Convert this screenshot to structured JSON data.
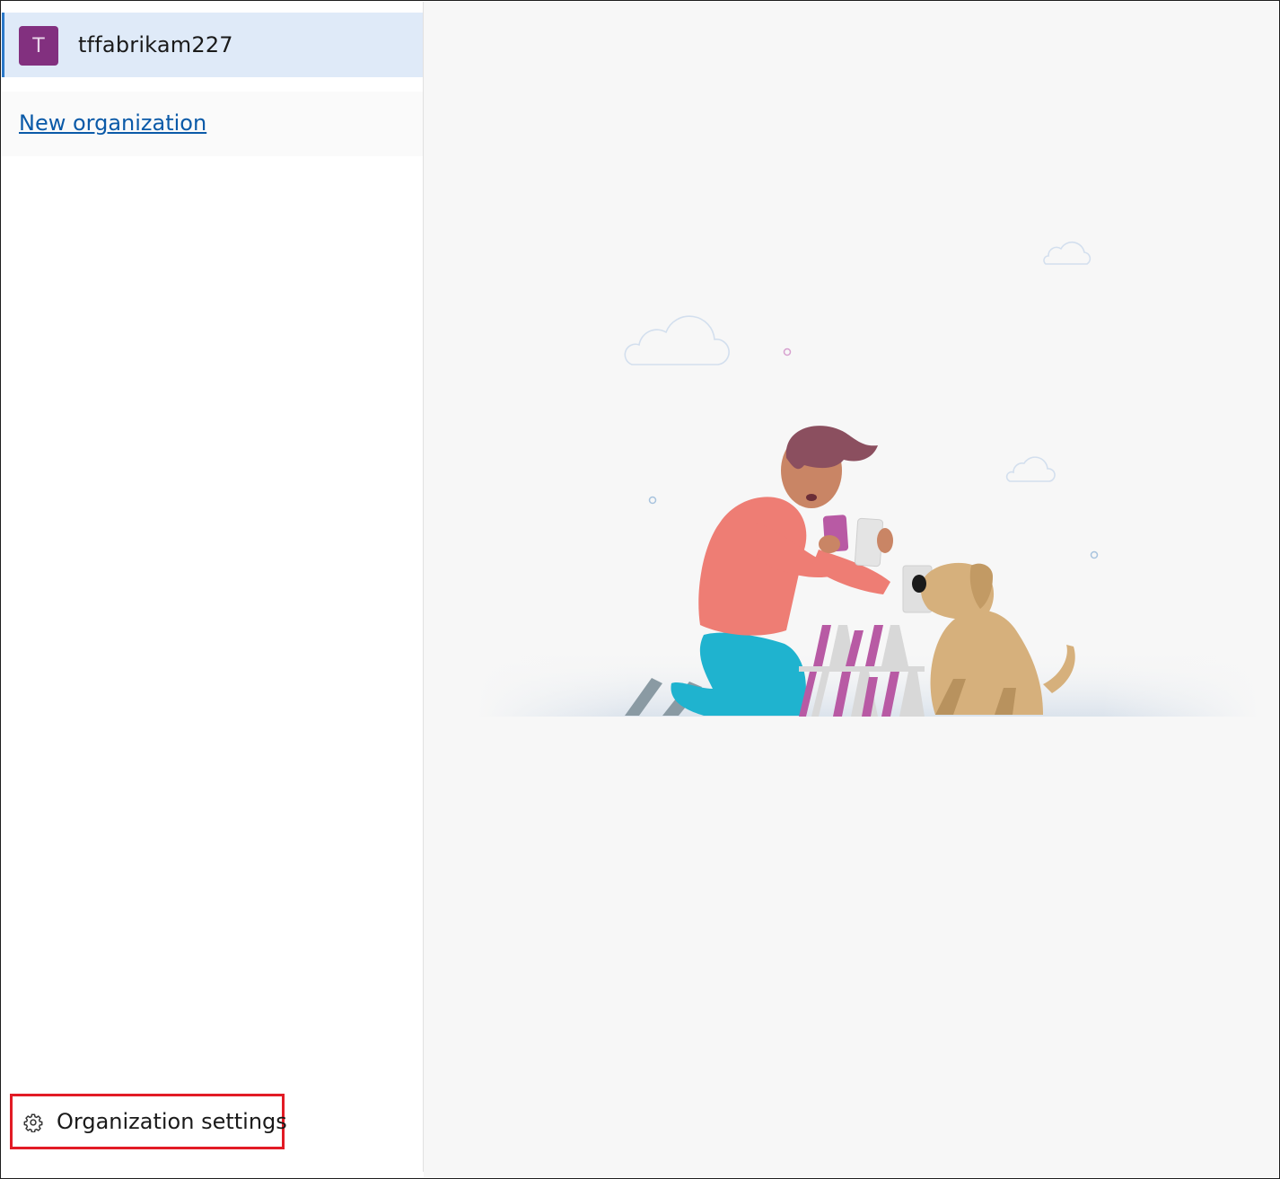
{
  "sidebar": {
    "organizations": [
      {
        "initial": "T",
        "name": "tffabrikam227",
        "selected": true,
        "avatar_color": "#82307f"
      }
    ],
    "new_organization_link": "New organization",
    "settings": {
      "label": "Organization settings",
      "icon": "gear-icon",
      "highlight_color": "#e21b25"
    }
  },
  "main": {
    "illustration": "person-building-card-house-with-dog"
  },
  "colors": {
    "selected_bg": "#dfeaf8",
    "selected_accent": "#2b79c9",
    "link": "#0b5aa8",
    "main_bg": "#f7f7f7"
  }
}
